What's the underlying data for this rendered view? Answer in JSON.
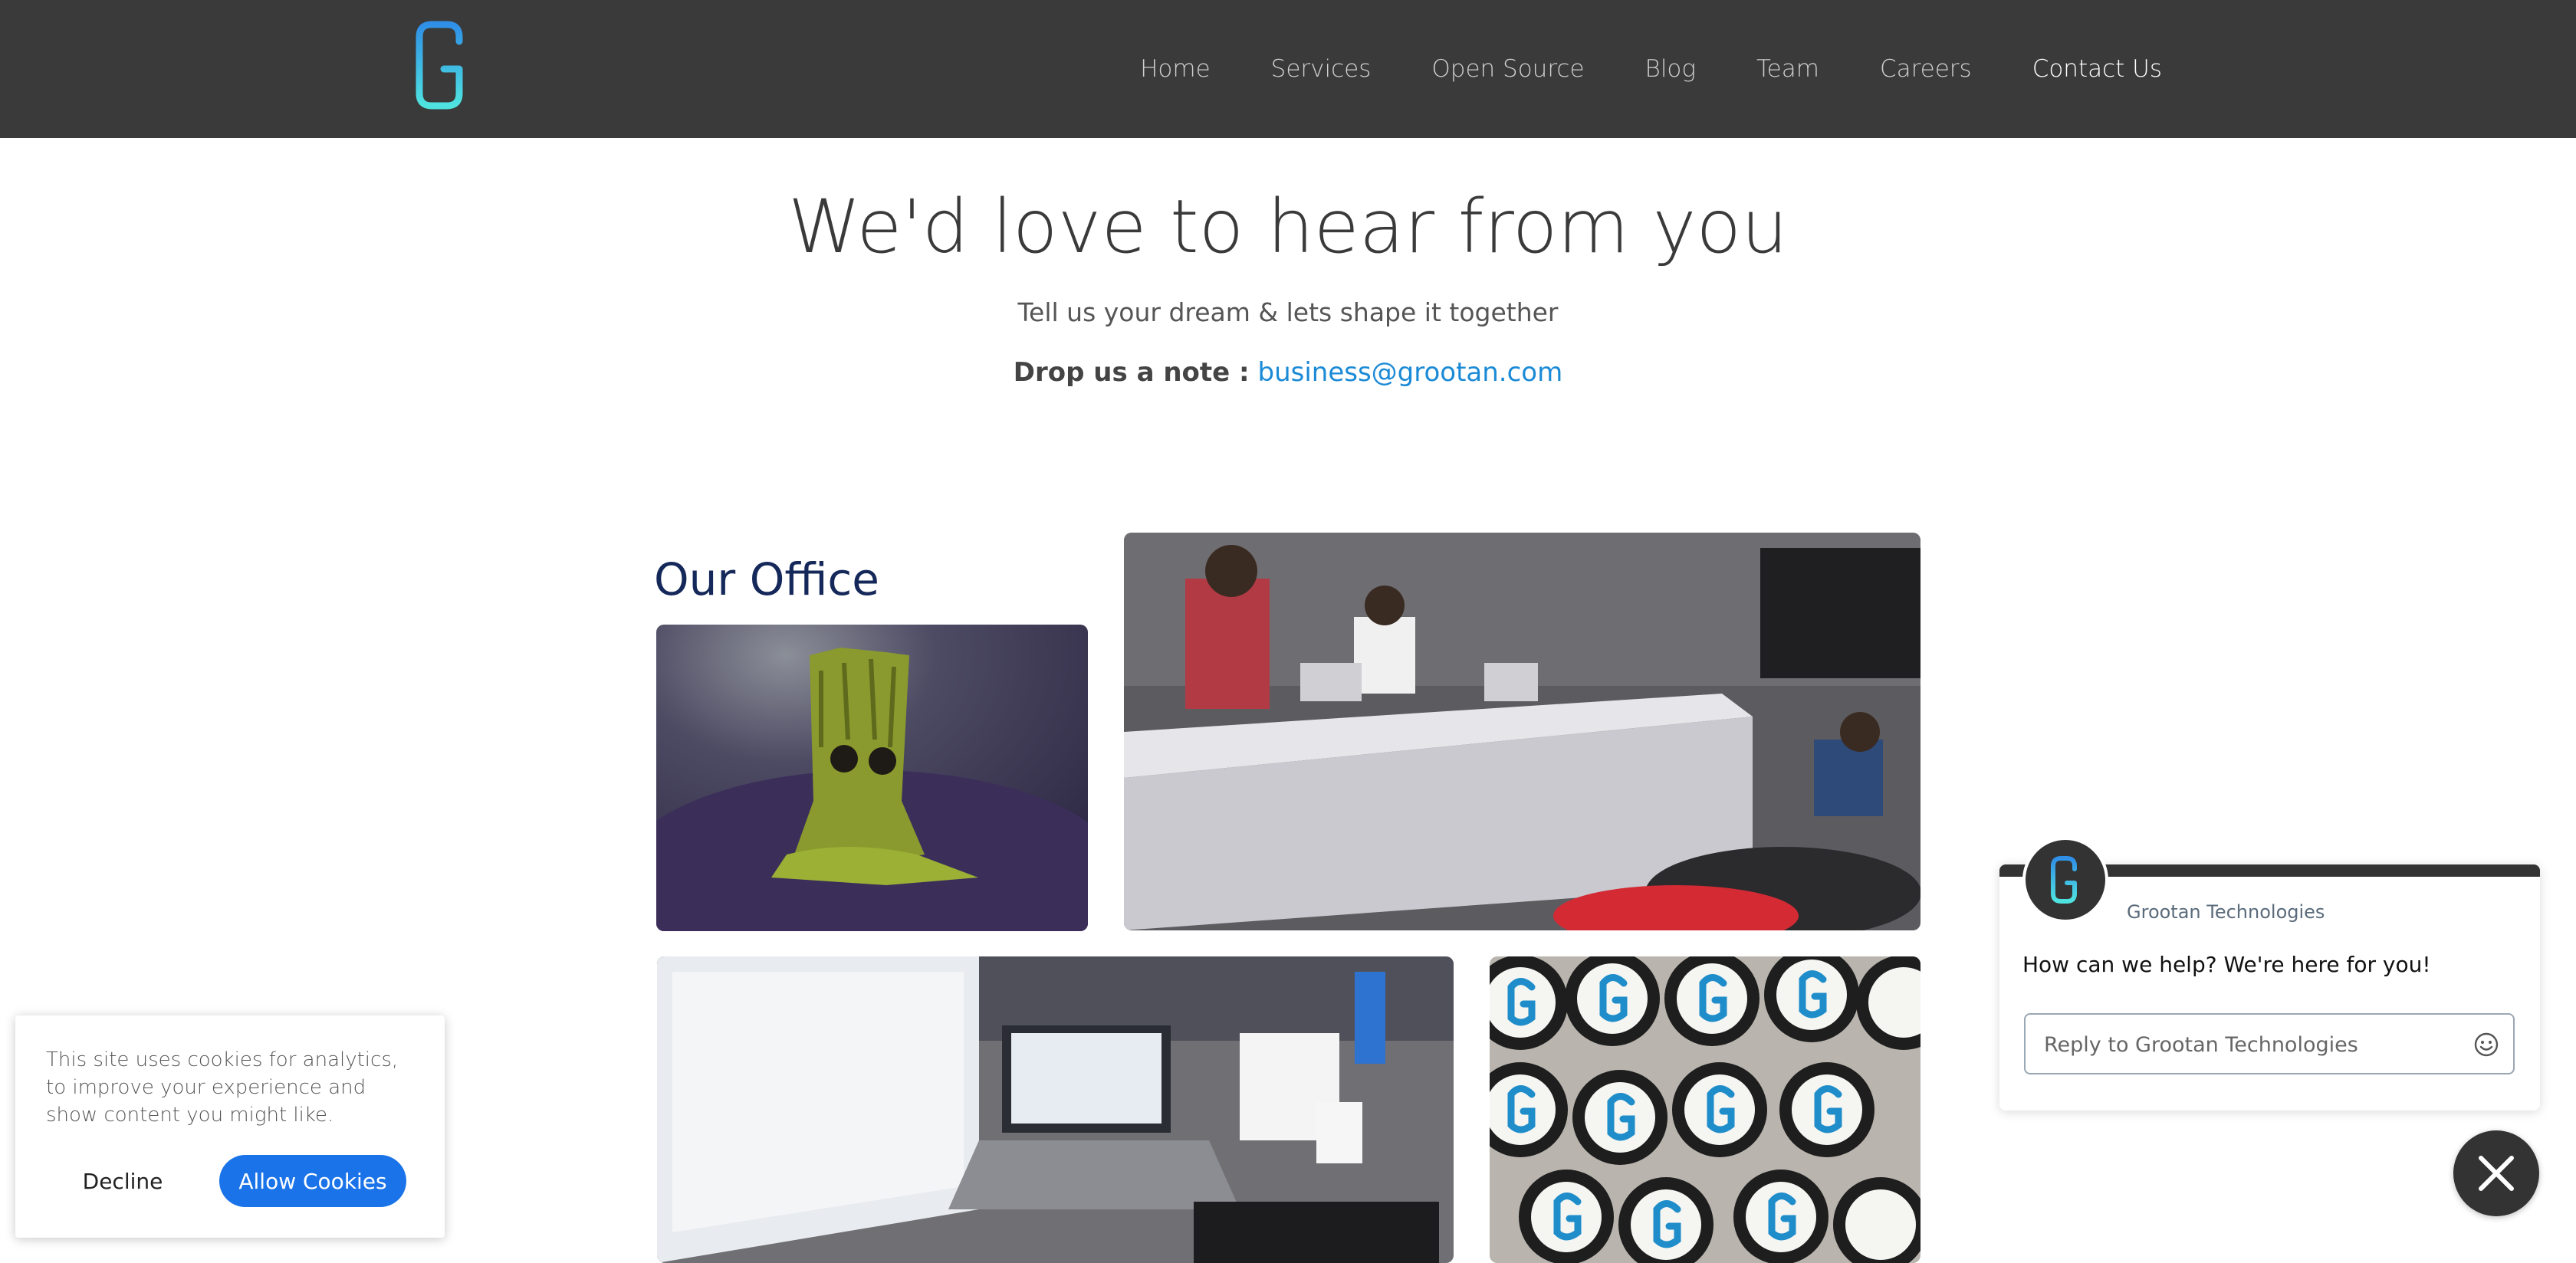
{
  "nav": {
    "items": [
      {
        "label": "Home"
      },
      {
        "label": "Services"
      },
      {
        "label": "Open Source"
      },
      {
        "label": "Blog"
      },
      {
        "label": "Team"
      },
      {
        "label": "Careers"
      },
      {
        "label": "Contact Us"
      }
    ]
  },
  "hero": {
    "title": "We'd love to hear from you",
    "subtitle": "Tell us your dream & lets shape it together",
    "note_label": "Drop us a note :",
    "email": "business@grootan.com"
  },
  "office": {
    "title": "Our Office"
  },
  "cookie": {
    "text": "This site uses cookies for analytics, to improve your experience and show content you might like.",
    "decline_label": "Decline",
    "allow_label": "Allow Cookies"
  },
  "chat": {
    "company_name": "Grootan Technologies",
    "message": "How can we help? We're here for you!",
    "input_placeholder": "Reply to Grootan Technologies"
  },
  "colors": {
    "header_bg": "#3a3a3a",
    "link_blue": "#1b8ad6",
    "allow_button": "#1a73e8",
    "office_title": "#15285a"
  }
}
